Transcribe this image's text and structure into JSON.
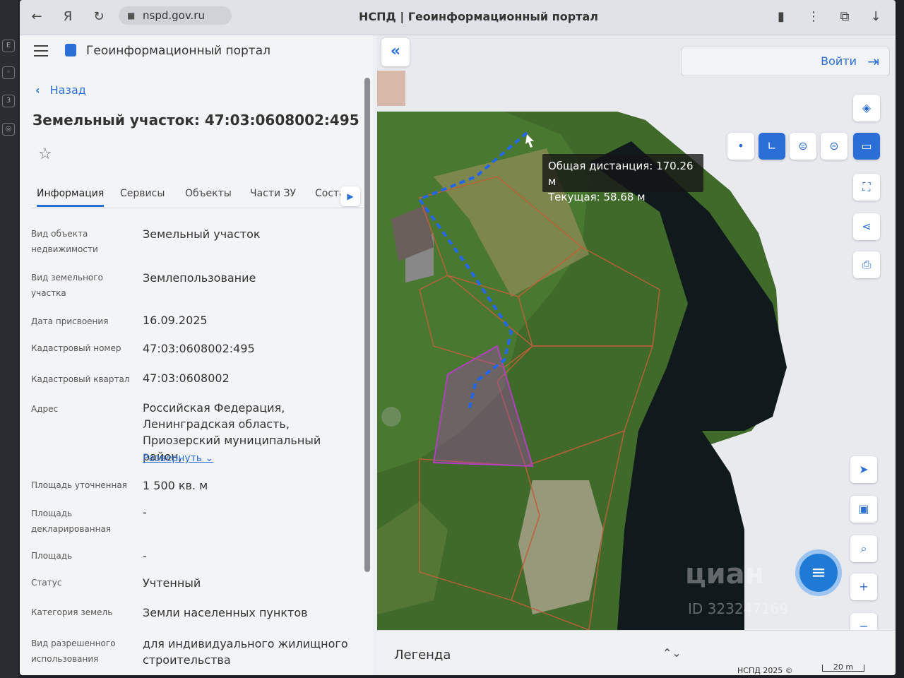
{
  "browser": {
    "url": "nspd.gov.ru",
    "tab_title": "НСПД | Геоинформационный портал"
  },
  "panel": {
    "portal_title": "Геоинформационный портал",
    "back_label": "Назад",
    "object_title": "Земельный участок: 47:03:0608002:495",
    "tabs": [
      "Информация",
      "Сервисы",
      "Объекты",
      "Части ЗУ",
      "Соста"
    ],
    "expand_label": "Развернуть",
    "fields": [
      {
        "label": "Вид объекта недвижимости",
        "value": "Земельный участок"
      },
      {
        "label": "Вид земельного участка",
        "value": "Землепользование"
      },
      {
        "label": "Дата присвоения",
        "value": "16.09.2025"
      },
      {
        "label": "Кадастровый номер",
        "value": "47:03:0608002:495"
      },
      {
        "label": "Кадастровый квартал",
        "value": "47:03:0608002"
      },
      {
        "label": "Адрес",
        "value": "Российская Федерация, Ленинградская область, Приозерский муниципальный район,"
      },
      {
        "label": "Площадь уточненная",
        "value": "1 500 кв. м"
      },
      {
        "label": "Площадь декларированная",
        "value": "-"
      },
      {
        "label": "Площадь",
        "value": "-"
      },
      {
        "label": "Статус",
        "value": "Учтенный"
      },
      {
        "label": "Категория земель",
        "value": "Земли населенных пунктов"
      },
      {
        "label": "Вид разрешенного использования",
        "value": "для индивидуального жилищного строительства"
      }
    ]
  },
  "map": {
    "login_label": "Войти",
    "measure_total": "Общая дистанция: 170.26 м",
    "measure_current": "Текущая: 58.68 м",
    "legend_label": "Легенда",
    "copyright": "НСПД 2025 ©",
    "scale_label": "20 m",
    "watermark": "циан",
    "watermark_id": "ID 323247169",
    "colors": {
      "accent": "#2b6fd6",
      "selected_parcel": "#b040c0",
      "parcel_border": "#c0603a",
      "measure_line": "#2266ee"
    },
    "icons": [
      "collapse-icon",
      "login-icon",
      "layers-icon",
      "point-icon",
      "line-measure-icon",
      "area-measure-icon",
      "area-measure2-icon",
      "ruler-icon",
      "select-area-icon",
      "share-icon",
      "print-icon",
      "locate-icon",
      "screen-icon",
      "search-icon",
      "zoom-in-icon",
      "zoom-out-icon",
      "chat-icon"
    ]
  }
}
